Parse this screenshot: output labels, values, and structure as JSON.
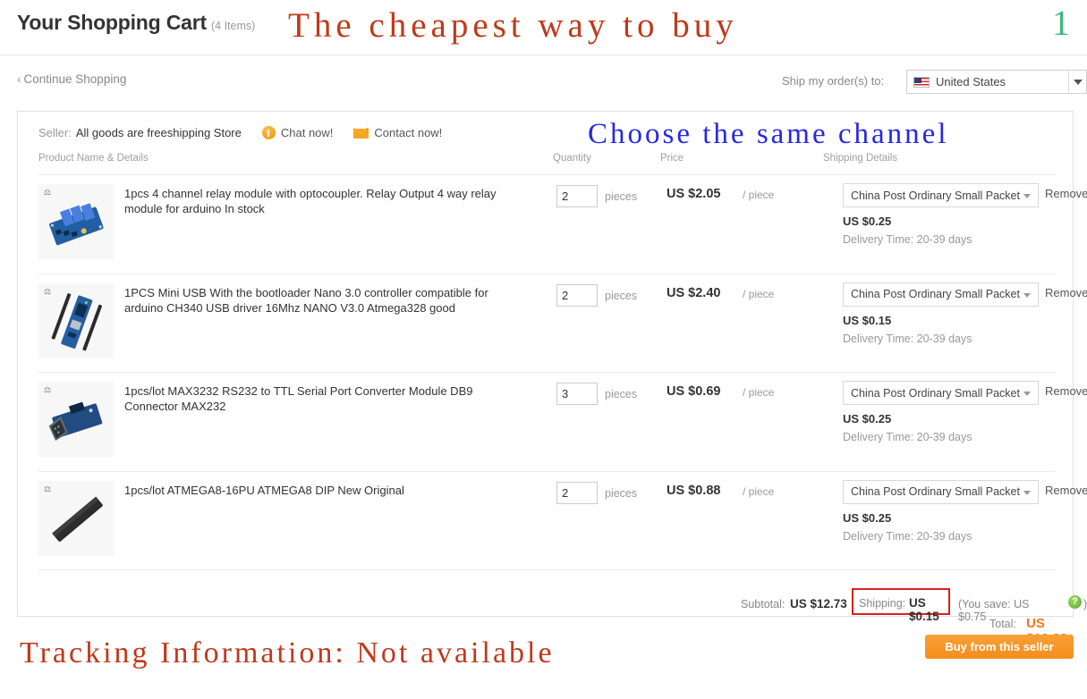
{
  "header": {
    "title": "Your Shopping Cart",
    "item_count": "(4 Items)",
    "annotation_top": "The cheapest way to buy",
    "marker": "1",
    "marker_color": "#3cb878",
    "annotation_color": "#c0391b"
  },
  "subbar": {
    "continue_shopping": "Continue Shopping",
    "chevron": "‹",
    "ship_label": "Ship my order(s) to:",
    "ship_country": "United States",
    "flag_icon": "us-flag-icon"
  },
  "seller": {
    "label": "Seller:",
    "name": "All goods are freeshipping Store",
    "chat_label": "Chat now!",
    "chat_icon": "chat-bubble-icon",
    "contact_label": "Contact now!",
    "contact_icon": "envelope-icon"
  },
  "annotation_choose": {
    "text": "Choose the same channel",
    "color": "#2727e8"
  },
  "columns": {
    "product": "Product Name & Details",
    "quantity": "Quantity",
    "price": "Price",
    "shipping": "Shipping Details"
  },
  "items": [
    {
      "name": "1pcs 4 channel relay module with optocoupler. Relay Output 4 way relay module for arduino In stock",
      "thumb": "relay-module-thumbnail",
      "qty": "2",
      "qty_unit": "pieces",
      "price": "US $2.05",
      "price_unit": "/ piece",
      "shipping_method": "China Post Ordinary Small Packet",
      "shipping_cost": "US $0.25",
      "delivery_time": "Delivery Time: 20-39 days",
      "remove": "Remove"
    },
    {
      "name": "1PCS Mini USB With the bootloader Nano 3.0 controller compatible for arduino CH340 USB driver 16Mhz NANO V3.0 Atmega328 good",
      "thumb": "nano-board-thumbnail",
      "qty": "2",
      "qty_unit": "pieces",
      "price": "US $2.40",
      "price_unit": "/ piece",
      "shipping_method": "China Post Ordinary Small Packet",
      "shipping_cost": "US $0.15",
      "delivery_time": "Delivery Time: 20-39 days",
      "remove": "Remove"
    },
    {
      "name": "1pcs/lot MAX3232 RS232 to TTL Serial Port Converter Module DB9 Connector MAX232",
      "thumb": "rs232-module-thumbnail",
      "qty": "3",
      "qty_unit": "pieces",
      "price": "US $0.69",
      "price_unit": "/ piece",
      "shipping_method": "China Post Ordinary Small Packet",
      "shipping_cost": "US $0.25",
      "delivery_time": "Delivery Time: 20-39 days",
      "remove": "Remove"
    },
    {
      "name": "1pcs/lot ATMEGA8-16PU ATMEGA8 DIP New Original",
      "thumb": "dip-chip-thumbnail",
      "qty": "2",
      "qty_unit": "pieces",
      "price": "US $0.88",
      "price_unit": "/ piece",
      "shipping_method": "China Post Ordinary Small Packet",
      "shipping_cost": "US $0.25",
      "delivery_time": "Delivery Time: 20-39 days",
      "remove": "Remove"
    }
  ],
  "totals": {
    "subtotal_label": "Subtotal:",
    "subtotal_value": "US $12.73",
    "shipping_label": "Shipping:",
    "shipping_value": "US $0.15",
    "highlight_color": "#d81f1f",
    "save_text": "(You save: US $0.75",
    "save_paren": ")",
    "help_icon": "?",
    "total_label": "Total:",
    "total_value": "US $12.88",
    "total_color": "#f47421"
  },
  "footer": {
    "annotation_tracking": "Tracking Information: Not available",
    "buy_button": "Buy from this seller"
  }
}
